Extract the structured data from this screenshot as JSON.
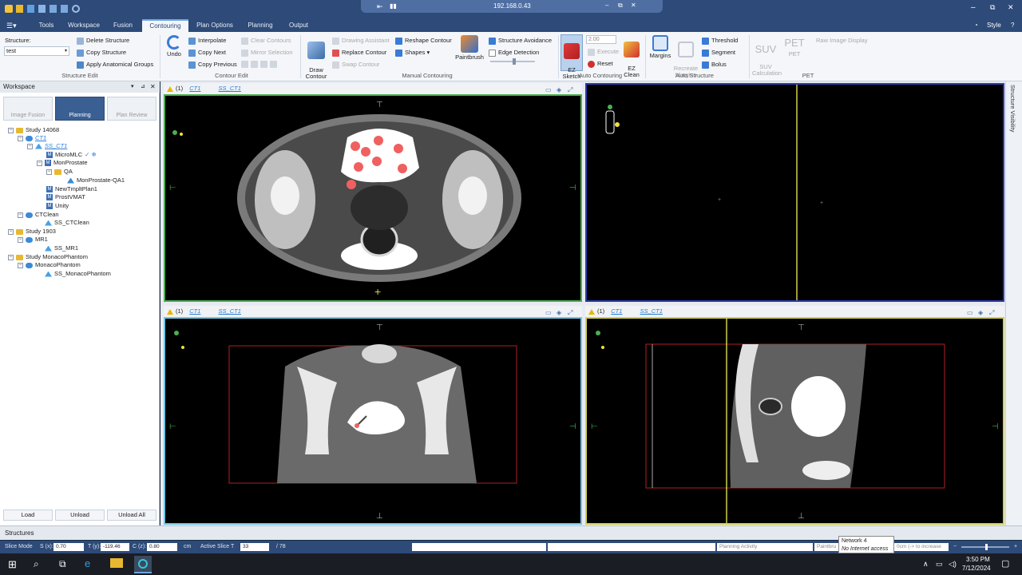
{
  "titlebar": {
    "remote_host": "192.168.0.43",
    "remote_minimize": "–",
    "remote_restore": "⧉",
    "remote_close": "✕",
    "minimize": "–",
    "restore": "⧉",
    "close": "✕"
  },
  "menu": {
    "tabs": [
      {
        "label": "Tools"
      },
      {
        "label": "Workspace"
      },
      {
        "label": "Fusion"
      },
      {
        "label": "Contouring"
      },
      {
        "label": "Plan Options"
      },
      {
        "label": "Planning"
      },
      {
        "label": "Output"
      }
    ],
    "style_label": "Style",
    "help_label": "?"
  },
  "ribbon": {
    "structure_edit": {
      "structure_label": "Structure:",
      "structure_value": "test",
      "delete": "Delete Structure",
      "copy": "Copy Structure",
      "apply_groups": "Apply Anatomical Groups",
      "group_label": "Structure Edit"
    },
    "contour_edit": {
      "undo": "Undo",
      "interpolate": "Interpolate",
      "copy_next": "Copy Next",
      "copy_previous": "Copy Previous",
      "clear_contours": "Clear Contours",
      "mirror_selection": "Mirror Selection",
      "group_label": "Contour Edit"
    },
    "manual_contouring": {
      "draw_contour": "Draw\nContour",
      "drawing_assistant": "Drawing Assistant",
      "replace_contour": "Replace Contour",
      "swap_contour": "Swap Contour",
      "reshape_contour": "Reshape Contour",
      "shapes": "Shapes",
      "paintbrush": "Paintbrush",
      "structure_avoidance": "Structure Avoidance",
      "edge_detection": "Edge Detection",
      "group_label": "Manual Contouring"
    },
    "auto_contouring": {
      "ez_sketch": "EZ\nSketch",
      "value": "2.00",
      "execute": "Execute",
      "reset": "Reset",
      "ez_clean": "EZ\nClean",
      "group_label": "Auto Contouring"
    },
    "auto_structure": {
      "margins": "Margins",
      "recreate_margins": "Recreate\nMargins",
      "threshold": "Threshold",
      "segment": "Segment",
      "bolus": "Bolus",
      "group_label": "Auto Structure"
    },
    "pet": {
      "suv": "SUV",
      "suv_calc": "SUV\nCalculation",
      "pet": "PET",
      "pet_sub": "PET",
      "raw_image": "Raw Image Display",
      "group_label": "PET"
    }
  },
  "workspace": {
    "title": "Workspace",
    "modes": [
      {
        "label": "Image Fusion"
      },
      {
        "label": "Planning"
      },
      {
        "label": "Plan Review"
      }
    ],
    "tree": [
      {
        "label": "Study 14068"
      },
      {
        "label": "CT1"
      },
      {
        "label": "SS_CT1"
      },
      {
        "label": "MicroMLC"
      },
      {
        "label": "MonProstate"
      },
      {
        "label": "QA"
      },
      {
        "label": "MonProstate-QA1"
      },
      {
        "label": "NewTmpltPlan1"
      },
      {
        "label": "ProstVMAT"
      },
      {
        "label": "Unity"
      },
      {
        "label": "CTClean"
      },
      {
        "label": "SS_CTClean"
      },
      {
        "label": "Study 1903"
      },
      {
        "label": "MR1"
      },
      {
        "label": "SS_MR1"
      },
      {
        "label": "Study MonacoPhantom"
      },
      {
        "label": "MonacoPhantom"
      },
      {
        "label": "SS_MonacoPhantom"
      }
    ],
    "load": "Load",
    "unload": "Unload",
    "unload_all": "Unload All"
  },
  "viewports": [
    {
      "count": "(1)",
      "img": "CT1",
      "ss": "SS_CT1"
    },
    {
      "count": "(1)",
      "img": "CT1",
      "ss": "SS_CT1"
    },
    {
      "count": "(1)",
      "img": "CT1",
      "ss": "SS_CT1"
    }
  ],
  "sidebar": {
    "label": "Structure Visibility"
  },
  "structures_label": "Structures",
  "status": {
    "slice_mode": "Slice Mode",
    "s_label": "S (x):",
    "s_value": "0.70",
    "t_label": "T (y):",
    "t_value": "-119.46",
    "c_label": "C (z):",
    "c_value": "0.80",
    "unit": "cm",
    "active_slice_label": "Active Slice T",
    "active_slice_value": "33",
    "slice_total": "/ 78",
    "planning_activity": "Planning Activity",
    "paintbrush": "Paintbru",
    "hint": "0cm (-> to increase"
  },
  "tooltip": {
    "line1": "Network 4",
    "line2": "No Internet access"
  },
  "taskbar": {
    "time": "3:50 PM",
    "date": "7/12/2024"
  },
  "colors": {
    "brand": "#2d4a78",
    "accent": "#3a5f93",
    "link": "#2a7fd4",
    "axial_border": "#4caf50",
    "sagittal_border": "#d4d04a",
    "coronal_border": "#6ec6e6",
    "blank_border": "#2e3bb0"
  }
}
